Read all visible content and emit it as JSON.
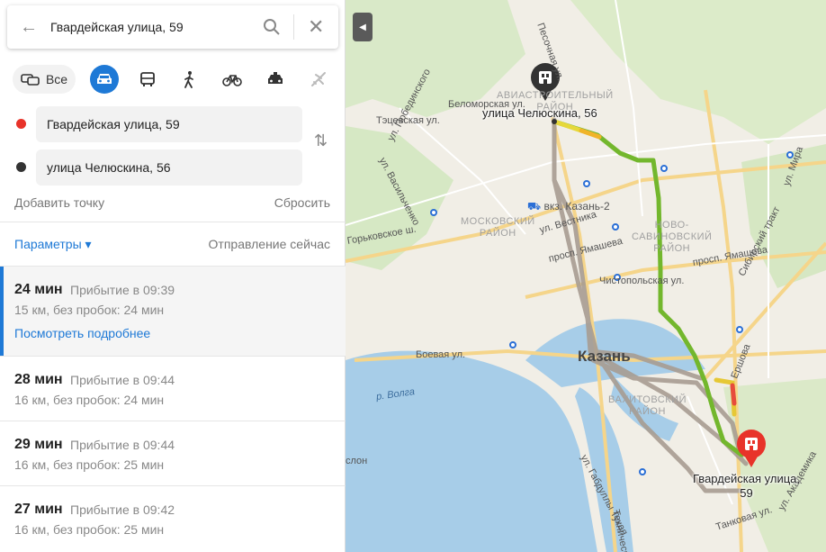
{
  "search": {
    "value": "Гвардейская улица, 59"
  },
  "modes": {
    "all_label": "Все",
    "items": [
      "car-icon",
      "bus-icon",
      "pedestrian-icon",
      "bicycle-icon",
      "taxi-icon",
      "plane-icon"
    ],
    "selected": "car-icon"
  },
  "points": {
    "from": {
      "label": "Гвардейская улица, 59",
      "color": "#e8332a"
    },
    "to": {
      "label": "улица Челюскина, 56",
      "color": "#333333"
    }
  },
  "actions": {
    "add_point": "Добавить точку",
    "reset": "Сбросить"
  },
  "options": {
    "params": "Параметры ▾",
    "departure": "Отправление сейчас"
  },
  "routes": [
    {
      "time": "24 мин",
      "arrival": "Прибытие в 09:39",
      "info": "15 км, без пробок: 24 мин",
      "more": "Посмотреть подробнее",
      "active": true
    },
    {
      "time": "28 мин",
      "arrival": "Прибытие в 09:44",
      "info": "16 км, без пробок: 24 мин"
    },
    {
      "time": "29 мин",
      "arrival": "Прибытие в 09:44",
      "info": "16 км, без пробок: 25 мин"
    },
    {
      "time": "27 мин",
      "arrival": "Прибытие в 09:42",
      "info": "16 км, без пробок: 25 мин"
    }
  ],
  "map": {
    "city": "Казань",
    "districts": {
      "aviastr": "АВИАСТРОИТЕЛЬНЫЙ\nРАЙОН",
      "moskovsky": "МОСКОВСКИЙ\nРАЙОН",
      "novosav": "НОВО-\nСАВИНОВСКИЙ\nРАЙОН",
      "vakhit": "ВАХИТОВСКИЙ\nРАЙОН"
    },
    "streets": {
      "belomorskaya": "Беломорская ул.",
      "tetskaya": "Тэцевская ул.",
      "vasilchenko": "ул. Васильченко",
      "pobedy": "ул. Побединского",
      "gorkovskoe": "Горьковское ш.",
      "vestnik": "ул. Вестника",
      "yamasheva1": "просп. Ямашева",
      "yamasheva2": "просп. Ямашева",
      "chistopolskaya": "Чистопольская ул.",
      "boevaya": "Боевая ул.",
      "sibirsky": "Сибирский тракт",
      "ershova": "Ершова",
      "gabdulla": "ул. Габдуллы Тукая",
      "tekhnicheskaya": "Техническая",
      "tankovaya": "Танковая ул.",
      "mira": "ул. Мира",
      "pesochnaya": "Песочная ул.",
      "akademika": "ул. Академика",
      "slon": "слон"
    },
    "station": "вкз. Казань-2",
    "river": "р. Волга",
    "pin_to": "улица Челюскина, 56",
    "pin_from": "Гвардейская улица,\n59"
  }
}
